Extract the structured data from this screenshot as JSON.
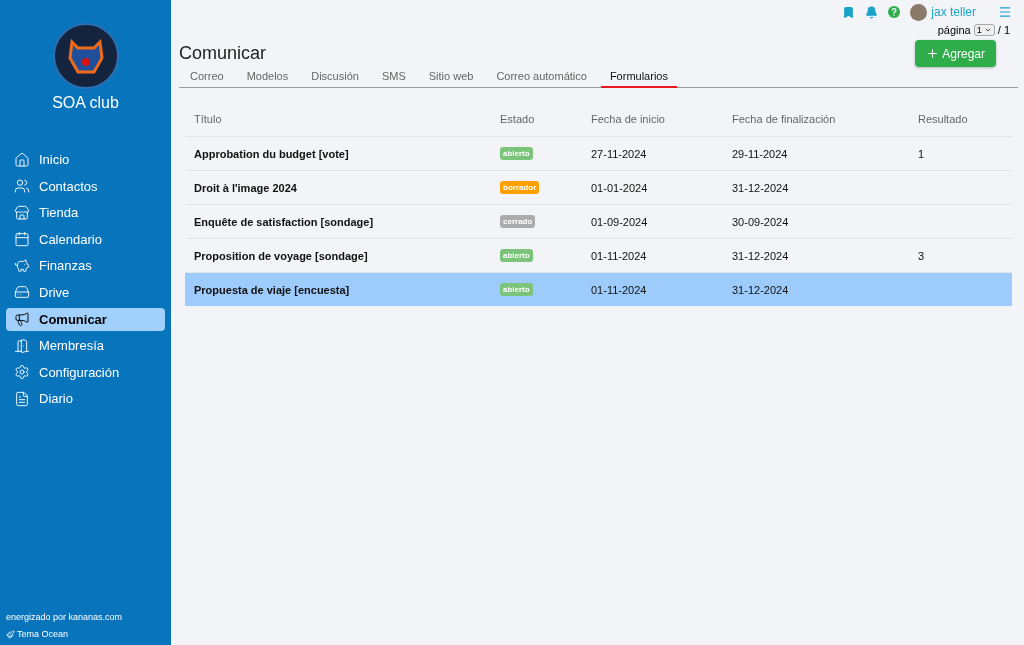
{
  "sidebar": {
    "club_name": "SOA club",
    "items": [
      {
        "label": "Inicio",
        "selected": false
      },
      {
        "label": "Contactos",
        "selected": false
      },
      {
        "label": "Tienda",
        "selected": false
      },
      {
        "label": "Calendario",
        "selected": false
      },
      {
        "label": "Finanzas",
        "selected": false
      },
      {
        "label": "Drive",
        "selected": false
      },
      {
        "label": "Comunicar",
        "selected": true
      },
      {
        "label": "Membresía",
        "selected": false
      },
      {
        "label": "Configuración",
        "selected": false
      },
      {
        "label": "Diario",
        "selected": false
      }
    ],
    "powered_by": "energizado por kananas.com",
    "theme": "Tema Ocean"
  },
  "header": {
    "user": "jax teller",
    "page_label": "página",
    "page_value": "1",
    "page_total": "/ 1"
  },
  "title": "Comunicar",
  "add_button": "Agregar",
  "tabs": [
    {
      "label": "Correo",
      "selected": false
    },
    {
      "label": "Modelos",
      "selected": false
    },
    {
      "label": "Discusión",
      "selected": false
    },
    {
      "label": "SMS",
      "selected": false
    },
    {
      "label": "Sitio web",
      "selected": false
    },
    {
      "label": "Correo automático",
      "selected": false
    },
    {
      "label": "Formularios",
      "selected": true
    }
  ],
  "table": {
    "columns": [
      "Título",
      "Estado",
      "Fecha de inicio",
      "Fecha de finalización",
      "Resultado"
    ],
    "rows": [
      {
        "title": "Approbation du budget [vote]",
        "status": {
          "label": "abierto",
          "color": "#7cc47a"
        },
        "start": "27-11-2024",
        "end": "29-11-2024",
        "result": "1",
        "selected": false
      },
      {
        "title": "Droit à l'image 2024",
        "status": {
          "label": "borrador",
          "color": "#ffa000"
        },
        "start": "01-01-2024",
        "end": "31-12-2024",
        "result": "",
        "selected": false
      },
      {
        "title": "Enquête de satisfaction [sondage]",
        "status": {
          "label": "cerrado",
          "color": "#acacac"
        },
        "start": "01-09-2024",
        "end": "30-09-2024",
        "result": "",
        "selected": false
      },
      {
        "title": "Proposition de voyage [sondage]",
        "status": {
          "label": "abierto",
          "color": "#7cc47a"
        },
        "start": "01-11-2024",
        "end": "31-12-2024",
        "result": "3",
        "selected": false
      },
      {
        "title": "Propuesta de viaje [encuesta]",
        "status": {
          "label": "abierto",
          "color": "#7cc47a"
        },
        "start": "01-11-2024",
        "end": "31-12-2024",
        "result": "",
        "selected": true
      }
    ]
  }
}
